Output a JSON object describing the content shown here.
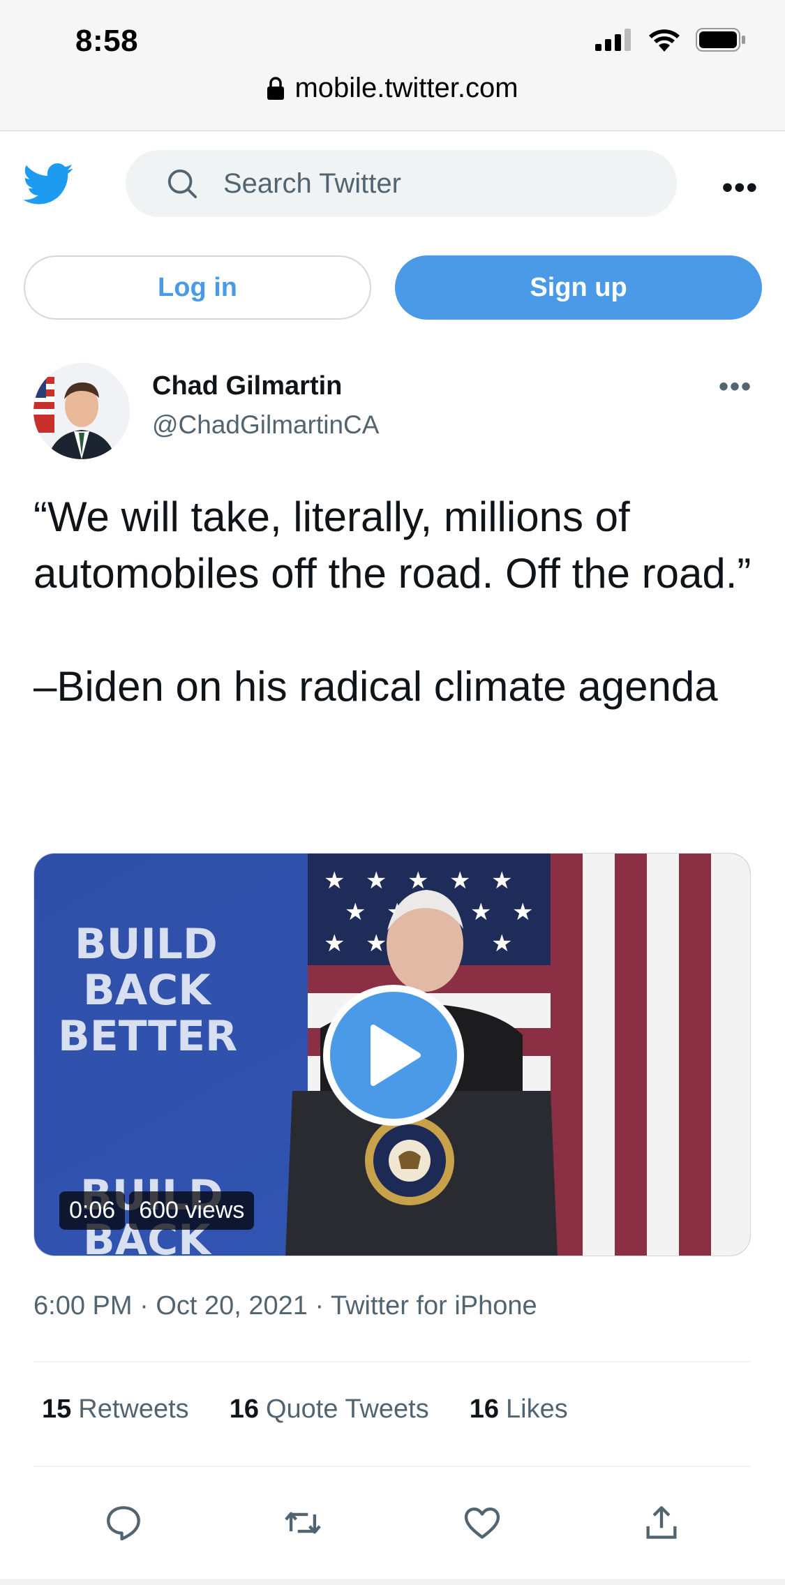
{
  "status_bar": {
    "time": "8:58"
  },
  "browser": {
    "url": "mobile.twitter.com"
  },
  "header": {
    "search_placeholder": "Search Twitter",
    "login_label": "Log in",
    "signup_label": "Sign up"
  },
  "tweet": {
    "author_name": "Chad Gilmartin",
    "author_handle": "@ChadGilmartinCA",
    "text": "“We will take, literally, millions of automobiles off the road. Off the road.”\n\n–Biden on his radical climate agenda",
    "video": {
      "duration": "0:06",
      "views": "600 views",
      "banner_text": "BUILD\nBACK\nBETTER",
      "banner_text_lower": "BUILD\nBACK"
    },
    "time": "6:00 PM",
    "date": "Oct 20, 2021",
    "source": "Twitter for iPhone",
    "stats": {
      "retweets_count": "15",
      "retweets_label": "Retweets",
      "quotes_count": "16",
      "quotes_label": "Quote Tweets",
      "likes_count": "16",
      "likes_label": "Likes"
    }
  },
  "colors": {
    "accent": "#4b9ae8",
    "text_primary": "#0f1419",
    "text_secondary": "#536471"
  },
  "icons": [
    "lock-icon",
    "signal-icon",
    "wifi-icon",
    "battery-icon",
    "twitter-bird-icon",
    "search-icon",
    "more-icon",
    "play-icon",
    "reply-icon",
    "retweet-icon",
    "like-icon",
    "share-icon"
  ]
}
